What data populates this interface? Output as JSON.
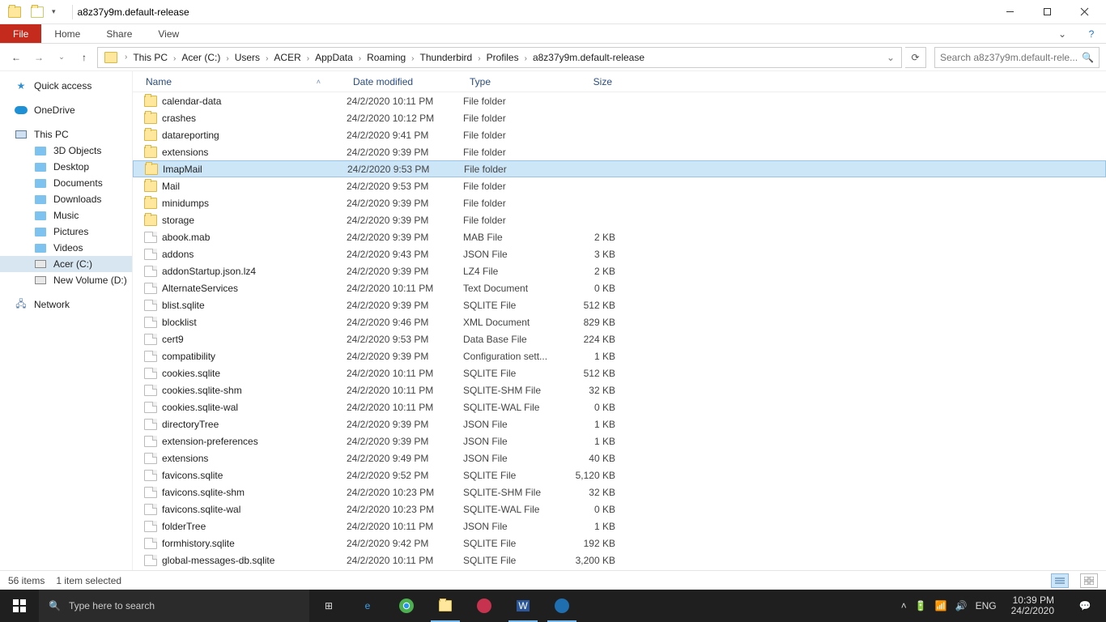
{
  "titlebar": {
    "title": "a8z37y9m.default-release"
  },
  "ribbon": {
    "file": "File",
    "tabs": [
      "Home",
      "Share",
      "View"
    ]
  },
  "breadcrumb": [
    "This PC",
    "Acer (C:)",
    "Users",
    "ACER",
    "AppData",
    "Roaming",
    "Thunderbird",
    "Profiles",
    "a8z37y9m.default-release"
  ],
  "search": {
    "placeholder": "Search a8z37y9m.default-rele..."
  },
  "navpane": {
    "quick": "Quick access",
    "onedrive": "OneDrive",
    "thispc": "This PC",
    "thispc_children": [
      "3D Objects",
      "Desktop",
      "Documents",
      "Downloads",
      "Music",
      "Pictures",
      "Videos",
      "Acer (C:)",
      "New Volume (D:)"
    ],
    "network": "Network"
  },
  "columns": {
    "name": "Name",
    "date": "Date modified",
    "type": "Type",
    "size": "Size"
  },
  "files": [
    {
      "name": "calendar-data",
      "date": "24/2/2020 10:11 PM",
      "type": "File folder",
      "size": "",
      "icon": "folder"
    },
    {
      "name": "crashes",
      "date": "24/2/2020 10:12 PM",
      "type": "File folder",
      "size": "",
      "icon": "folder"
    },
    {
      "name": "datareporting",
      "date": "24/2/2020 9:41 PM",
      "type": "File folder",
      "size": "",
      "icon": "folder"
    },
    {
      "name": "extensions",
      "date": "24/2/2020 9:39 PM",
      "type": "File folder",
      "size": "",
      "icon": "folder"
    },
    {
      "name": "ImapMail",
      "date": "24/2/2020 9:53 PM",
      "type": "File folder",
      "size": "",
      "icon": "folder",
      "selected": true
    },
    {
      "name": "Mail",
      "date": "24/2/2020 9:53 PM",
      "type": "File folder",
      "size": "",
      "icon": "folder"
    },
    {
      "name": "minidumps",
      "date": "24/2/2020 9:39 PM",
      "type": "File folder",
      "size": "",
      "icon": "folder"
    },
    {
      "name": "storage",
      "date": "24/2/2020 9:39 PM",
      "type": "File folder",
      "size": "",
      "icon": "folder"
    },
    {
      "name": "abook.mab",
      "date": "24/2/2020 9:39 PM",
      "type": "MAB File",
      "size": "2 KB",
      "icon": "file"
    },
    {
      "name": "addons",
      "date": "24/2/2020 9:43 PM",
      "type": "JSON File",
      "size": "3 KB",
      "icon": "file"
    },
    {
      "name": "addonStartup.json.lz4",
      "date": "24/2/2020 9:39 PM",
      "type": "LZ4 File",
      "size": "2 KB",
      "icon": "file"
    },
    {
      "name": "AlternateServices",
      "date": "24/2/2020 10:11 PM",
      "type": "Text Document",
      "size": "0 KB",
      "icon": "file"
    },
    {
      "name": "blist.sqlite",
      "date": "24/2/2020 9:39 PM",
      "type": "SQLITE File",
      "size": "512 KB",
      "icon": "file"
    },
    {
      "name": "blocklist",
      "date": "24/2/2020 9:46 PM",
      "type": "XML Document",
      "size": "829 KB",
      "icon": "file"
    },
    {
      "name": "cert9",
      "date": "24/2/2020 9:53 PM",
      "type": "Data Base File",
      "size": "224 KB",
      "icon": "file"
    },
    {
      "name": "compatibility",
      "date": "24/2/2020 9:39 PM",
      "type": "Configuration sett...",
      "size": "1 KB",
      "icon": "file"
    },
    {
      "name": "cookies.sqlite",
      "date": "24/2/2020 10:11 PM",
      "type": "SQLITE File",
      "size": "512 KB",
      "icon": "file"
    },
    {
      "name": "cookies.sqlite-shm",
      "date": "24/2/2020 10:11 PM",
      "type": "SQLITE-SHM File",
      "size": "32 KB",
      "icon": "file"
    },
    {
      "name": "cookies.sqlite-wal",
      "date": "24/2/2020 10:11 PM",
      "type": "SQLITE-WAL File",
      "size": "0 KB",
      "icon": "file"
    },
    {
      "name": "directoryTree",
      "date": "24/2/2020 9:39 PM",
      "type": "JSON File",
      "size": "1 KB",
      "icon": "file"
    },
    {
      "name": "extension-preferences",
      "date": "24/2/2020 9:39 PM",
      "type": "JSON File",
      "size": "1 KB",
      "icon": "file"
    },
    {
      "name": "extensions",
      "date": "24/2/2020 9:49 PM",
      "type": "JSON File",
      "size": "40 KB",
      "icon": "file"
    },
    {
      "name": "favicons.sqlite",
      "date": "24/2/2020 9:52 PM",
      "type": "SQLITE File",
      "size": "5,120 KB",
      "icon": "file"
    },
    {
      "name": "favicons.sqlite-shm",
      "date": "24/2/2020 10:23 PM",
      "type": "SQLITE-SHM File",
      "size": "32 KB",
      "icon": "file"
    },
    {
      "name": "favicons.sqlite-wal",
      "date": "24/2/2020 10:23 PM",
      "type": "SQLITE-WAL File",
      "size": "0 KB",
      "icon": "file"
    },
    {
      "name": "folderTree",
      "date": "24/2/2020 10:11 PM",
      "type": "JSON File",
      "size": "1 KB",
      "icon": "file"
    },
    {
      "name": "formhistory.sqlite",
      "date": "24/2/2020 9:42 PM",
      "type": "SQLITE File",
      "size": "192 KB",
      "icon": "file"
    },
    {
      "name": "global-messages-db.sqlite",
      "date": "24/2/2020 10:11 PM",
      "type": "SQLITE File",
      "size": "3,200 KB",
      "icon": "file"
    }
  ],
  "status": {
    "count": "56 items",
    "selected": "1 item selected"
  },
  "taskbar": {
    "search_placeholder": "Type here to search",
    "lang": "ENG",
    "time": "10:39 PM",
    "date": "24/2/2020"
  }
}
